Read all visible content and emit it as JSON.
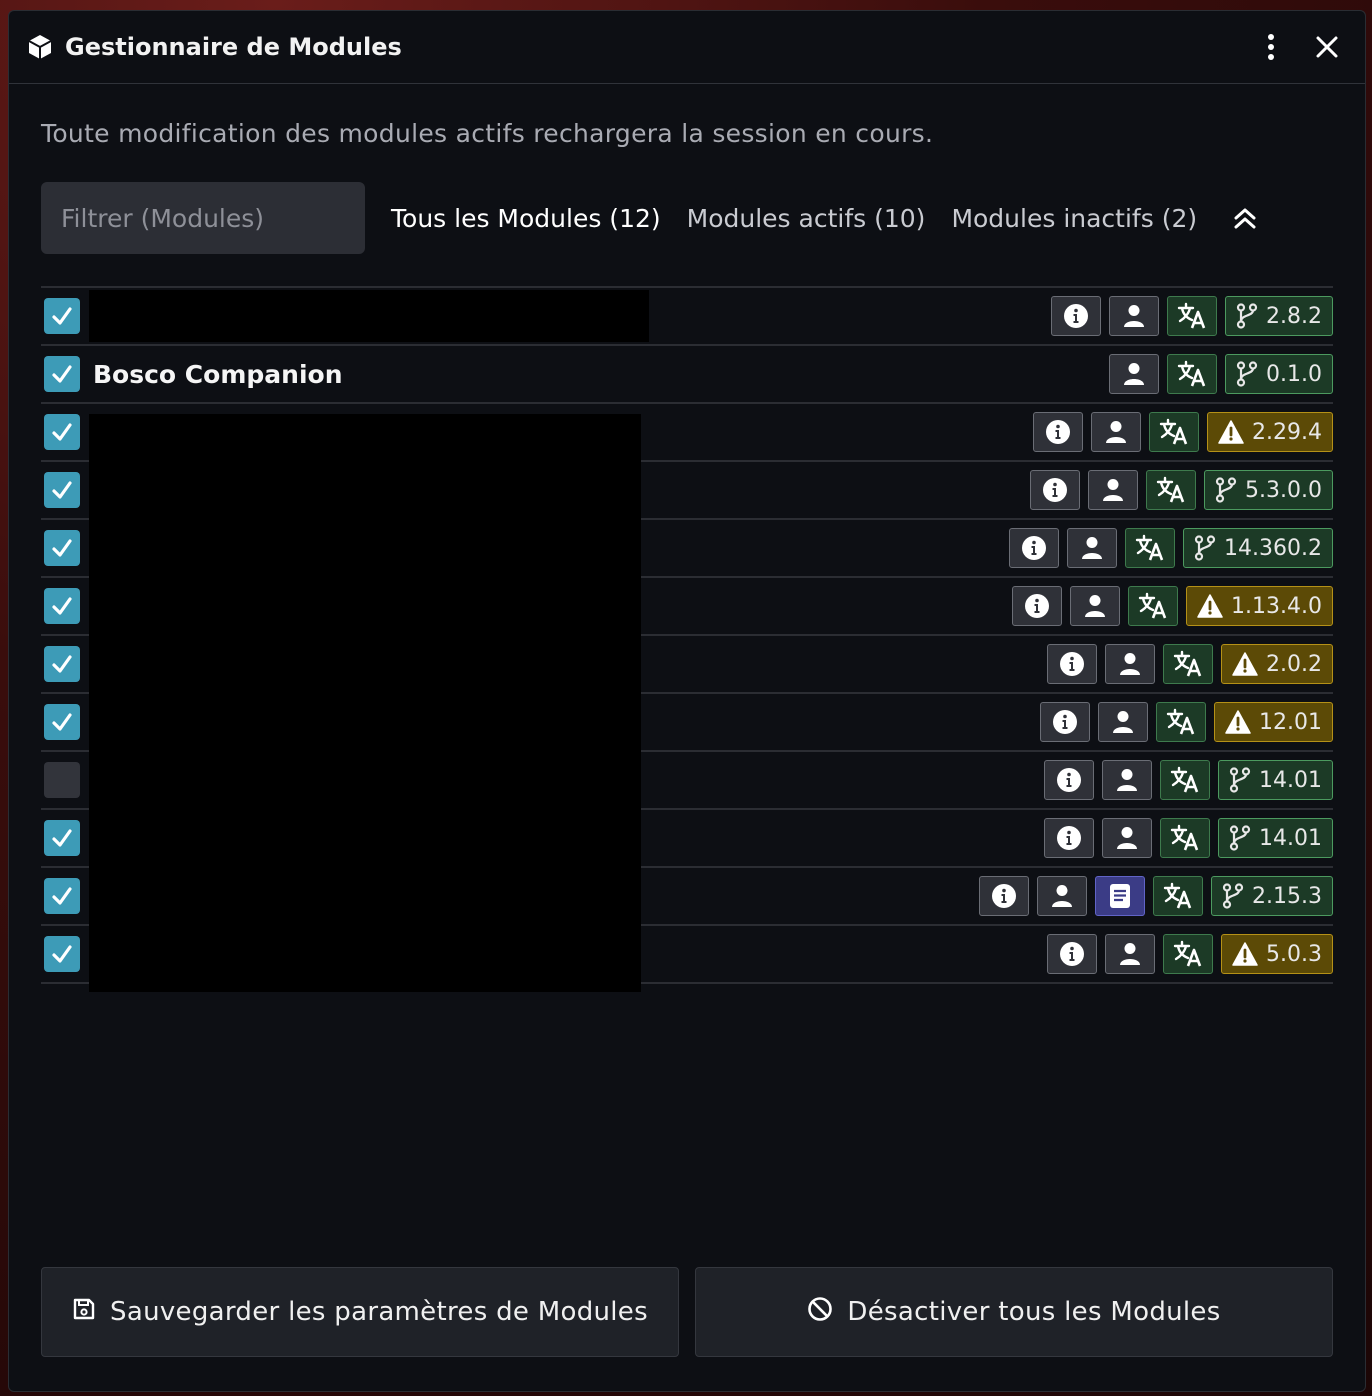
{
  "window": {
    "title": "Gestionnaire de Modules"
  },
  "notice": "Toute modification des modules actifs rechargera la session en cours.",
  "filter": {
    "placeholder": "Filtrer (Modules)",
    "value": ""
  },
  "tabs": [
    {
      "label": "Tous les Modules (12)",
      "active": true
    },
    {
      "label": "Modules actifs (10)",
      "active": false
    },
    {
      "label": "Modules inactifs (2)",
      "active": false
    }
  ],
  "modules": [
    {
      "name": "",
      "checked": true,
      "info": true,
      "author": true,
      "doc": false,
      "lang": true,
      "version": "2.8.2",
      "status": "ok"
    },
    {
      "name": "Bosco Companion",
      "checked": true,
      "info": false,
      "author": true,
      "doc": false,
      "lang": true,
      "version": "0.1.0",
      "status": "ok"
    },
    {
      "name": "",
      "checked": true,
      "info": true,
      "author": true,
      "doc": false,
      "lang": true,
      "version": "2.29.4",
      "status": "warn"
    },
    {
      "name": "",
      "checked": true,
      "info": true,
      "author": true,
      "doc": false,
      "lang": true,
      "version": "5.3.0.0",
      "status": "ok"
    },
    {
      "name": "",
      "checked": true,
      "info": true,
      "author": true,
      "doc": false,
      "lang": true,
      "version": "14.360.2",
      "status": "ok"
    },
    {
      "name": "",
      "checked": true,
      "info": true,
      "author": true,
      "doc": false,
      "lang": true,
      "version": "1.13.4.0",
      "status": "warn"
    },
    {
      "name": "",
      "checked": true,
      "info": true,
      "author": true,
      "doc": false,
      "lang": true,
      "version": "2.0.2",
      "status": "warn"
    },
    {
      "name": "",
      "checked": true,
      "info": true,
      "author": true,
      "doc": false,
      "lang": true,
      "version": "12.01",
      "status": "warn"
    },
    {
      "name": "",
      "checked": false,
      "info": true,
      "author": true,
      "doc": false,
      "lang": true,
      "version": "14.01",
      "status": "ok"
    },
    {
      "name": "",
      "checked": true,
      "info": true,
      "author": true,
      "doc": false,
      "lang": true,
      "version": "14.01",
      "status": "ok"
    },
    {
      "name": "",
      "checked": true,
      "info": true,
      "author": true,
      "doc": true,
      "lang": true,
      "version": "2.15.3",
      "status": "ok"
    },
    {
      "name": "",
      "checked": true,
      "info": true,
      "author": true,
      "doc": false,
      "lang": true,
      "version": "5.0.3",
      "status": "warn"
    }
  ],
  "footer": {
    "save_label": "Sauvegarder les paramètres de Modules",
    "deactivate_label": "Désactiver tous les Modules"
  },
  "colors": {
    "checkbox_on": "#3d9bb7",
    "version_ok": "#1c3a26",
    "version_warn": "#5c4a06",
    "doc_badge": "#3b3c86"
  },
  "icons": {
    "title": "cube-icon",
    "menu": "kebab-menu-icon",
    "close": "close-icon",
    "collapse": "chevrons-up-icon",
    "info": "info-icon",
    "author": "user-icon",
    "doc": "book-icon",
    "lang": "translate-icon",
    "ok": "git-branch-icon",
    "warn": "warning-icon",
    "save": "floppy-icon",
    "deactivate": "ban-icon"
  }
}
